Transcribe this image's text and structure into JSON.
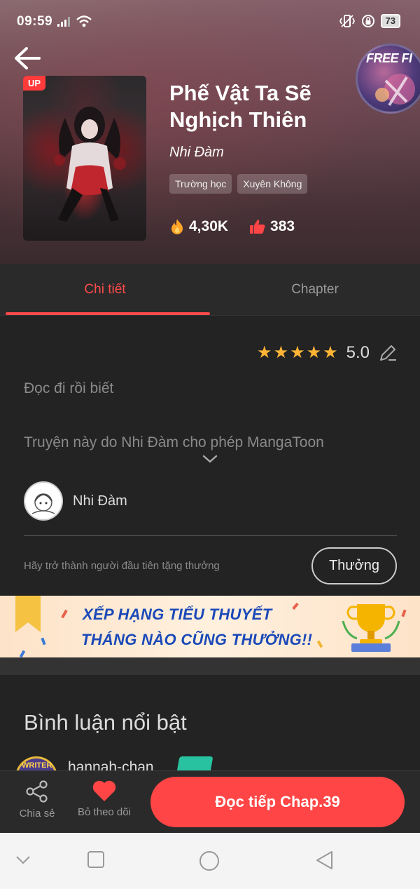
{
  "status_bar": {
    "time": "09:59",
    "battery": "73"
  },
  "floating_ad": {
    "label": "FREE FI"
  },
  "manga": {
    "cover_badge": "UP",
    "title": "Phế Vật Ta Sẽ Nghịch Thiên",
    "author": "Nhi Đàm",
    "tags": [
      "Trường học",
      "Xuyên Không"
    ],
    "views": "4,30K",
    "likes": "383"
  },
  "tabs": [
    {
      "label": "Chi tiết",
      "active": true
    },
    {
      "label": "Chapter",
      "active": false
    }
  ],
  "details": {
    "rating": "5.0",
    "stars": 5,
    "description": "Đọc đi rồi biết",
    "permission_note": "Truyện này do Nhi Đàm cho phép MangaToon",
    "author_name": "Nhi Đàm",
    "gift_prompt": "Hãy trở thành người đầu tiên tặng thưởng",
    "gift_button": "Thưởng"
  },
  "banner": {
    "line1": "XẾP HẠNG TIỂU THUYẾT",
    "line2": "THÁNG NÀO CŨNG THƯỞNG!!"
  },
  "comments": {
    "title": "Bình luận nổi bật",
    "first_user": "hannah-chan",
    "first_avatar_label": "WRITER"
  },
  "actions": {
    "share_label": "Chia sẻ",
    "unfollow_label": "Bỏ theo dõi",
    "read_button": "Đọc tiếp Chap.39"
  },
  "colors": {
    "accent": "#ff4545",
    "star": "#ffb436",
    "background": "#232323"
  }
}
